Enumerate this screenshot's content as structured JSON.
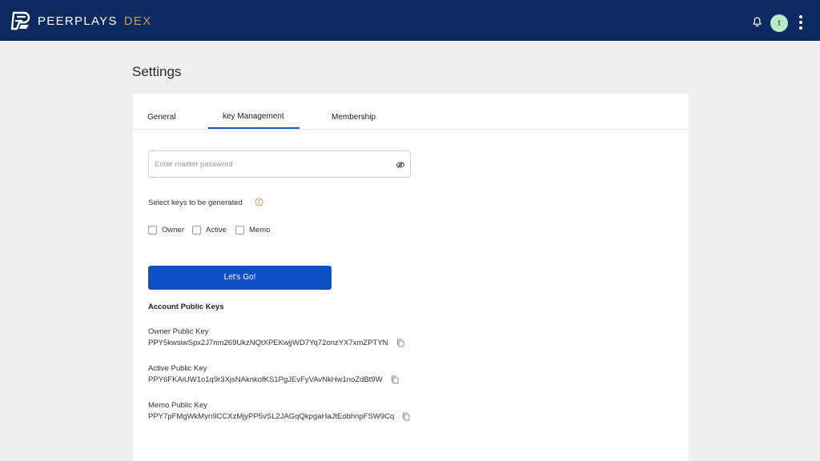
{
  "header": {
    "brand": "PEERPLAYS",
    "brand_suffix": "DEX",
    "avatar_initial": "t",
    "colors": {
      "bar": "#0b2a62",
      "suffix": "#c59b5b",
      "avatar": "#b7ebc7"
    },
    "icons": [
      "peerplays-logo-icon",
      "bell-icon",
      "more-vertical-icon"
    ]
  },
  "page": {
    "title": "Settings"
  },
  "tabs": [
    {
      "label": "General",
      "active": false
    },
    {
      "label": "key Management",
      "active": true
    },
    {
      "label": "Membership",
      "active": false
    }
  ],
  "form": {
    "password_placeholder": "Enter master password",
    "password_value": "",
    "select_keys_label": "Select keys to be generated",
    "checkboxes": [
      {
        "label": "Owner",
        "checked": false
      },
      {
        "label": "Active",
        "checked": false
      },
      {
        "label": "Memo",
        "checked": false
      }
    ],
    "submit_label": "Let's Go!"
  },
  "public_keys": {
    "title": "Account Public Keys",
    "keys": [
      {
        "label": "Owner Public Key",
        "value": "PPY5kwsiwSpx2J7nm269UkzNQtXPEKwjjWD7Yq72onzYX7xmZPTYN"
      },
      {
        "label": "Active Public Key",
        "value": "PPY6FKAiUW1o1q9r3XjsNAknkofKS1PgJEvFyVAvNkHw1noZdBt9W"
      },
      {
        "label": "Memo Public Key",
        "value": "PPY7pFMgWkMyn9CCXzMjyPP5vSL2JAGqQkpgaHaJtEobhnpFSW9Cq"
      }
    ]
  },
  "accent_color": "#0f4fc6"
}
